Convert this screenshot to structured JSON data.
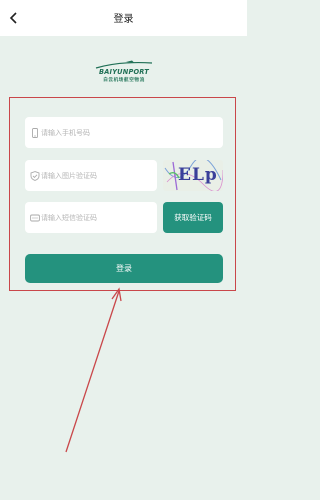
{
  "header": {
    "title": "登录"
  },
  "logo": {
    "text": "BAIYUNPORT",
    "subtitle": "白云机场航空物流"
  },
  "form": {
    "phone_placeholder": "请输入手机号码",
    "image_code_placeholder": "请输入图片验证码",
    "sms_code_placeholder": "请输入短信验证码",
    "captcha_text": "ELp",
    "sms_button_label": "获取验证码",
    "login_button_label": "登录"
  },
  "colors": {
    "accent": "#24927e",
    "background": "#e8f1ec",
    "annotation": "#c9474a"
  },
  "icons": {
    "back": "chevron-left-icon",
    "phone": "phone-icon",
    "shield": "shield-check-icon",
    "message": "message-icon",
    "logo": "airplane-logo-icon"
  }
}
